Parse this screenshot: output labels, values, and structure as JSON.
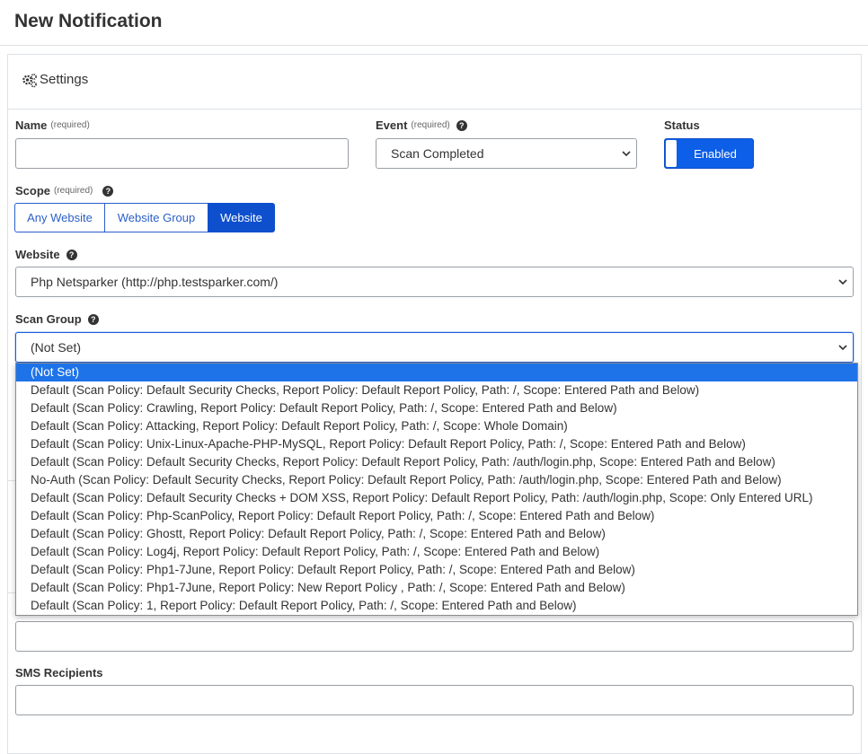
{
  "page": {
    "title": "New Notification"
  },
  "settings": {
    "title": "Settings",
    "icon": "gears-icon"
  },
  "form": {
    "name": {
      "label": "Name",
      "required": "(required)",
      "value": ""
    },
    "event": {
      "label": "Event",
      "required": "(required)",
      "value": "Scan Completed"
    },
    "status": {
      "label": "Status",
      "value": "Enabled"
    },
    "scope": {
      "label": "Scope",
      "required": "(required)",
      "options": [
        "Any Website",
        "Website Group",
        "Website"
      ],
      "selected": "Website"
    },
    "website": {
      "label": "Website",
      "value": "Php Netsparker (http://php.testsparker.com/)"
    },
    "scan_group": {
      "label": "Scan Group",
      "value": "(Not Set)",
      "options": [
        "(Not Set)",
        "Default (Scan Policy: Default Security Checks, Report Policy: Default Report Policy, Path: /, Scope: Entered Path and Below)",
        "Default (Scan Policy: Crawling, Report Policy: Default Report Policy, Path: /, Scope: Entered Path and Below)",
        "Default (Scan Policy: Attacking, Report Policy: Default Report Policy, Path: /, Scope: Whole Domain)",
        "Default (Scan Policy: Unix-Linux-Apache-PHP-MySQL, Report Policy: Default Report Policy, Path: /, Scope: Entered Path and Below)",
        "Default (Scan Policy: Default Security Checks, Report Policy: Default Report Policy, Path: /auth/login.php, Scope: Entered Path and Below)",
        "No-Auth (Scan Policy: Default Security Checks, Report Policy: Default Report Policy, Path: /auth/login.php, Scope: Entered Path and Below)",
        "Default (Scan Policy: Default Security Checks + DOM XSS, Report Policy: Default Report Policy, Path: /auth/login.php, Scope: Only Entered URL)",
        "Default (Scan Policy: Php-ScanPolicy, Report Policy: Default Report Policy, Path: /, Scope: Entered Path and Below)",
        "Default (Scan Policy: Ghostt, Report Policy: Default Report Policy, Path: /, Scope: Entered Path and Below)",
        "Default (Scan Policy: Log4j, Report Policy: Default Report Policy, Path: /, Scope: Entered Path and Below)",
        "Default (Scan Policy: Php1-7June, Report Policy: Default Report Policy, Path: /, Scope: Entered Path and Below)",
        "Default (Scan Policy: Php1-7June, Report Policy: New Report Policy , Path: /, Scope: Entered Path and Below)",
        "Default (Scan Policy: 1, Report Policy: Default Report Policy, Path: /, Scope: Entered Path and Below)"
      ],
      "selected_index": 0
    },
    "email_recipients": {
      "value": ""
    },
    "sms_recipients": {
      "label": "SMS Recipients",
      "value": ""
    }
  },
  "colors": {
    "accent": "#0d5fe8",
    "selected_option": "#1e73e8",
    "border": "#dde1e5"
  }
}
